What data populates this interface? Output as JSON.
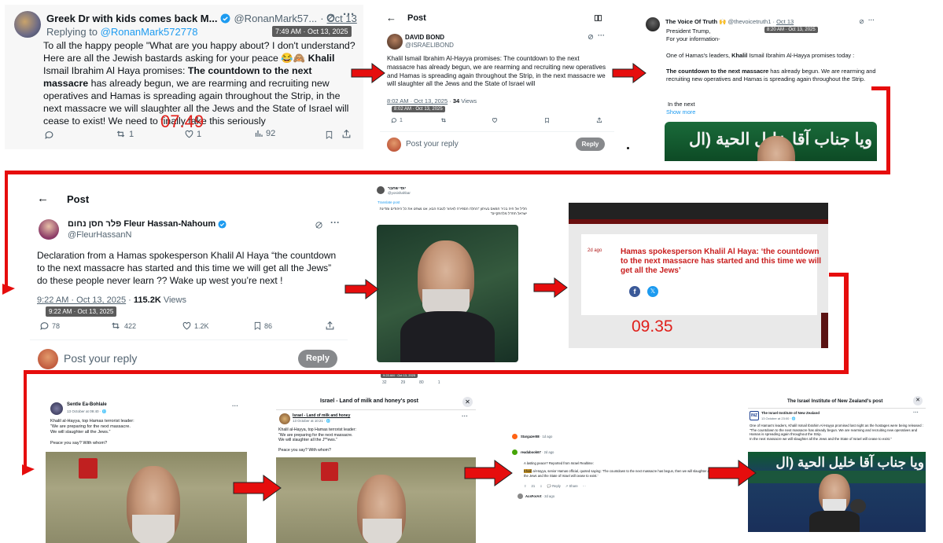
{
  "p1": {
    "name": "Greek Dr with kids comes back M...",
    "handle": "@RonanMark57...",
    "dot": "·",
    "date": "Oct 13",
    "replying_prefix": "Replying to ",
    "replying_handle": "@RonanMark572778",
    "tooltip": "7:49 AM · Oct 13, 2025",
    "text_1": "To all the happy people \"What are you happy about? I don't understand? Here are all the Jewish bastards asking for your peace ",
    "emoji_1": "😂🙈",
    "bold_1": "Khalil",
    "text_2": " Ismail Ibrahim Al Haya promises: ",
    "bold_2": "The countdown to the next massacre",
    "text_3": " has already begun, we are rearming and recruiting new operatives and Hamas is spreading again throughout the Strip, in the next massacre we will slaughter all the Jews and the State of Israel will cease to exist! We need to finally take this seriously",
    "overlay_time": "07.49",
    "retweets": "1",
    "likes": "1",
    "views": "92"
  },
  "p2": {
    "header": "Post",
    "name": "DAVID BOND",
    "handle": "@ISRAELIBOND",
    "text": "Khalil Ismail Ibrahim Al-Hayya promises: The countdown to the next massacre has already begun, we are rearming and recruiting new operatives and Hamas is spreading again throughout the Strip, in the next massacre we will slaughter all the Jews and the State of Israel will",
    "timestamp": "8:02 AM · Oct 13, 2025",
    "views_count": "34",
    "views_label": "Views",
    "tooltip": "8:02 AM · Oct 13, 2025",
    "replies": "1",
    "reply_placeholder": "Post your reply",
    "reply_button": "Reply"
  },
  "p3": {
    "name": "The Voice Of Truth 🙌",
    "handle": "@thevoicetruth1",
    "date": "Oct 13",
    "tooltip": "8:20 AM · Oct 13, 2025",
    "line1": "President Trump,",
    "line2": "For your information-",
    "para_a": "One of Hamas's leaders, ",
    "para_b": "Khalil",
    "para_c": " Ismail Ibrahim Al-Hayya promises today :",
    "bold": "The countdown to the next massacre",
    "rest": " has already begun. We are rearming and recruiting new operatives and Hamas is spreading again throughout the Strip.",
    "in_next": "In the next",
    "show_more": "Show more",
    "banner_arabic": "ويا جناب آقا خليل الحية (ال"
  },
  "p4": {
    "header": "Post",
    "name": "פלר חסן נחום Fleur Hassan-Nahoum",
    "handle": "@FleurHassanN",
    "text": "Declaration from a Hamas spokesperson Khalil Al Haya “the countdown to the next massacre has started and this time we will get all the Jews” do these people never learn ?? Wake up west you’re next !",
    "timestamp": "9:22 AM · Oct 13, 2025",
    "views_count": "115.2K",
    "views_label": "Views",
    "tooltip": "9:22 AM · Oct 13, 2025",
    "replies": "78",
    "retweets": "422",
    "likes": "1.2K",
    "bookmarks": "86",
    "reply_placeholder": "Post your reply",
    "reply_button": "Reply"
  },
  "p5": {
    "name": "יוסי שחבר",
    "handle": "@yosishahbar",
    "translate": "Translate post",
    "hebrew": "חליל אל חיה בכיר חמאס בעיתון \"החלה הספירה לאחור לטבח הבא, אנו נשחט את כל היהודים ומדינת ישראל תחדל מלהתקיים\"",
    "tooltip": "9:23 AM · Oct 13, 2025",
    "stat1": "32",
    "stat2": "29",
    "stat3": "80",
    "stat4": "1"
  },
  "p6": {
    "ago": "2d ago",
    "headline": "Hamas spokesperson Khalil Al Haya: ‘the countdown to the next massacre has started and this time we will get all the Jews’",
    "overlay_time": "09.35"
  },
  "p7": {
    "name": "Sentle Ea-Bohlale",
    "meta": "13 October at 09:40 · ",
    "body": "Khalil al-Hayya, top Hamas terrorist leader:\n“We are preparing for the next massacre.\nWe will slaughter all the Jews.”\n\nPeace you say? With whom?"
  },
  "p8": {
    "header": "Israel - Land of milk and honey's post",
    "name": "Israel - Land of milk and honey",
    "meta": "13 October at 10:21 · ",
    "body": "Khalil al-Hayya, top Hamas terrorist leader:\n“We are preparing for the next massacre.\nWe will slaughter all the J**ews.”\n\nPeace you say? With whom?"
  },
  "p9": {
    "c1_name": "Stargazer88",
    "c1_ago": "· 1d ago",
    "c2_name": "readabook67",
    "c2_ago": "· 2d ago",
    "c2_intro": "A lasting peace? Reported from Israel Realtime:",
    "c2_hl": "Khalil",
    "c2_text": " al-Hayya, senior Hamas official, quoted saying: 'The countdown to the next massacre has begun, then we will slaughter all the Jews and the State of Israel will cease to exist.'",
    "c2_votes": "21",
    "c2_reply": "Reply",
    "c2_share": "Share",
    "c3_name": "AcsForArt",
    "c3_ago": "· 2d ago"
  },
  "p10": {
    "header": "The Israel Institute of New Zealand's post",
    "name": "The Israel Institute of New Zealand",
    "meta": "13 October at 23:00 · ",
    "body": "One of Hamas's leaders, Khalil Ismail Ibrahim Al-Hayya promised last night as the hostages were being released :\n\"The countdown to the next massacre has already begun. We are rearming and recruiting new operatives and Hamas is spreading again throughout the Strip.\nIn the next massacre we will slaughter all the Jews and the State of Israel will cease to exist.\"",
    "banner_arabic": "ويا جناب آقا خليل الحية (ال"
  },
  "colors": {
    "red": "#e60d0d",
    "x_blue": "#1d9bf0",
    "verified": "#1d9bf0",
    "reply_btn": "#87898c",
    "headline_red": "#c81d1d"
  }
}
